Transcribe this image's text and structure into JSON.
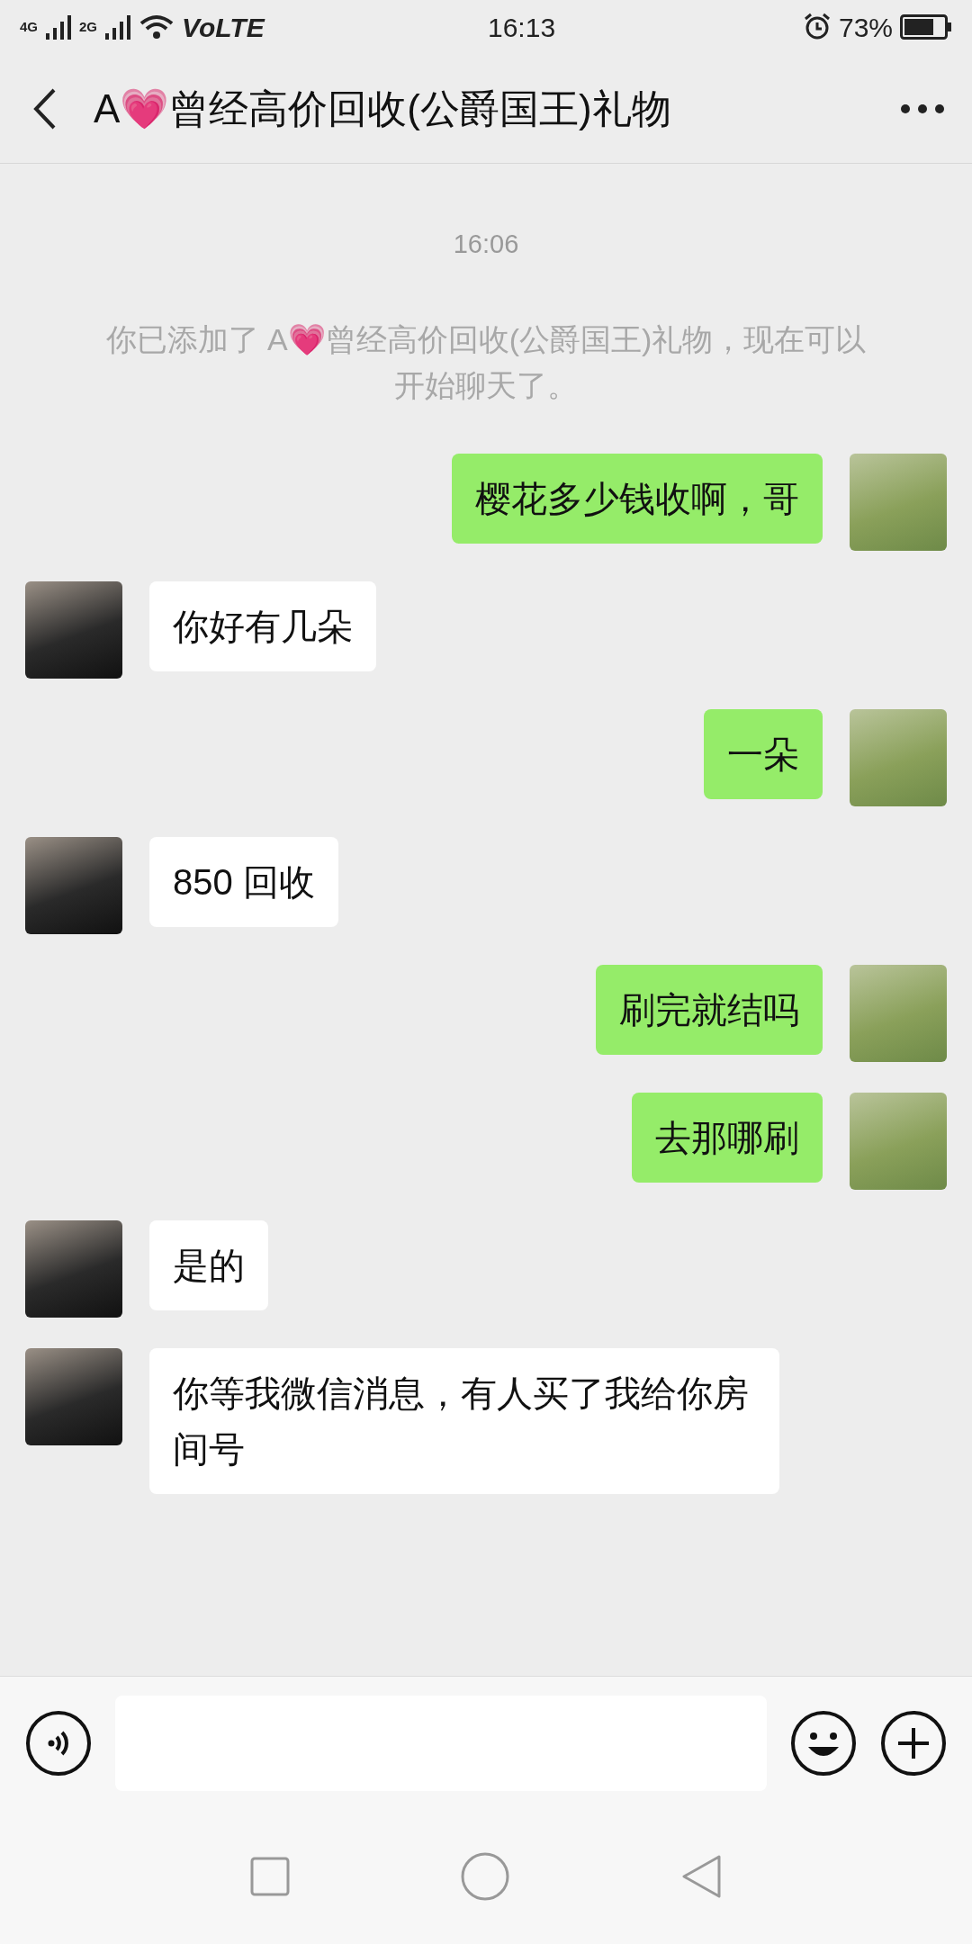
{
  "status_bar": {
    "network": "4G",
    "network_2": "2G",
    "volte": "VoLTE",
    "time": "16:13",
    "battery": "73%"
  },
  "header": {
    "title": "A💗曾经高价回收(公爵国王)礼物"
  },
  "chat": {
    "timestamp": "16:06",
    "system_message": "你已添加了 A💗曾经高价回收(公爵国王)礼物，现在可以开始聊天了。",
    "messages": [
      {
        "kind": "sent",
        "text": "樱花多少钱收啊，哥"
      },
      {
        "kind": "received",
        "text": "你好有几朵"
      },
      {
        "kind": "sent",
        "text": "一朵"
      },
      {
        "kind": "received",
        "text": "850 回收"
      },
      {
        "kind": "sent",
        "text": "刷完就结吗"
      },
      {
        "kind": "sent",
        "text": "去那哪刷"
      },
      {
        "kind": "received",
        "text": "是的"
      },
      {
        "kind": "received",
        "text": "你等我微信消息，有人买了我给你房间号"
      }
    ]
  }
}
